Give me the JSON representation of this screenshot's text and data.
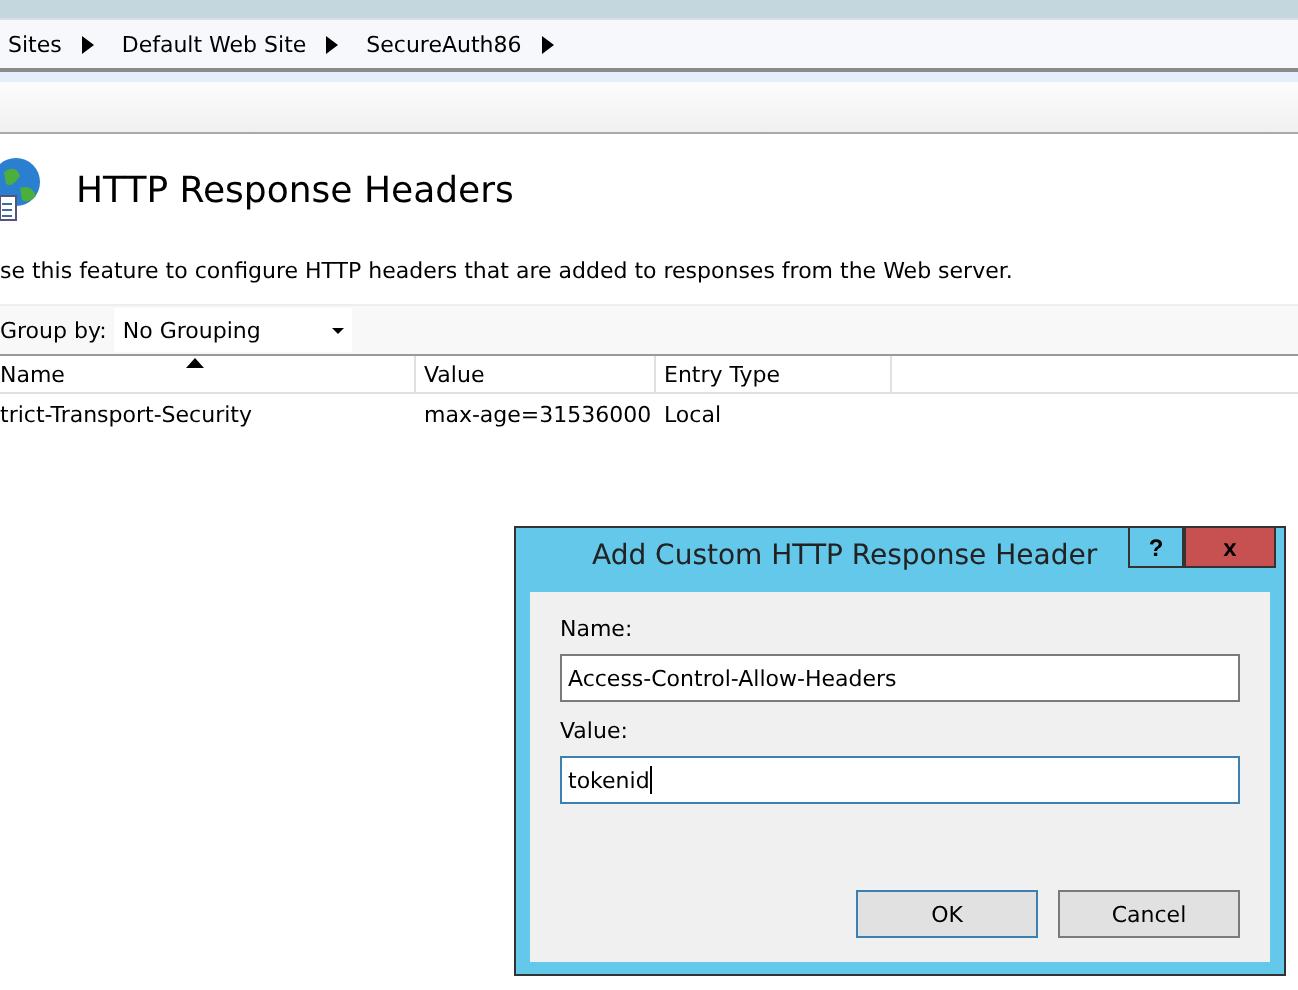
{
  "breadcrumb": [
    "Sites",
    "Default Web Site",
    "SecureAuth86"
  ],
  "page": {
    "title": "HTTP Response Headers",
    "description": "se this feature to configure HTTP headers that are added to responses from the Web server.",
    "group_by_label": "Group by:",
    "group_by_value": "No Grouping"
  },
  "table": {
    "columns": [
      {
        "label": "Name",
        "sorted": true
      },
      {
        "label": "Value",
        "sorted": false
      },
      {
        "label": "Entry Type",
        "sorted": false
      }
    ],
    "rows": [
      [
        "trict-Transport-Security",
        "max-age=31536000",
        "Local"
      ]
    ]
  },
  "dialog": {
    "title": "Add Custom HTTP Response Header",
    "help": "?",
    "close": "x",
    "fields": [
      {
        "label": "Name:",
        "value": "Access-Control-Allow-Headers",
        "focused": false
      },
      {
        "label": "Value:",
        "value": "tokenid",
        "focused": true
      }
    ],
    "buttons": [
      {
        "label": "OK",
        "default": true
      },
      {
        "label": "Cancel",
        "default": false
      }
    ]
  }
}
